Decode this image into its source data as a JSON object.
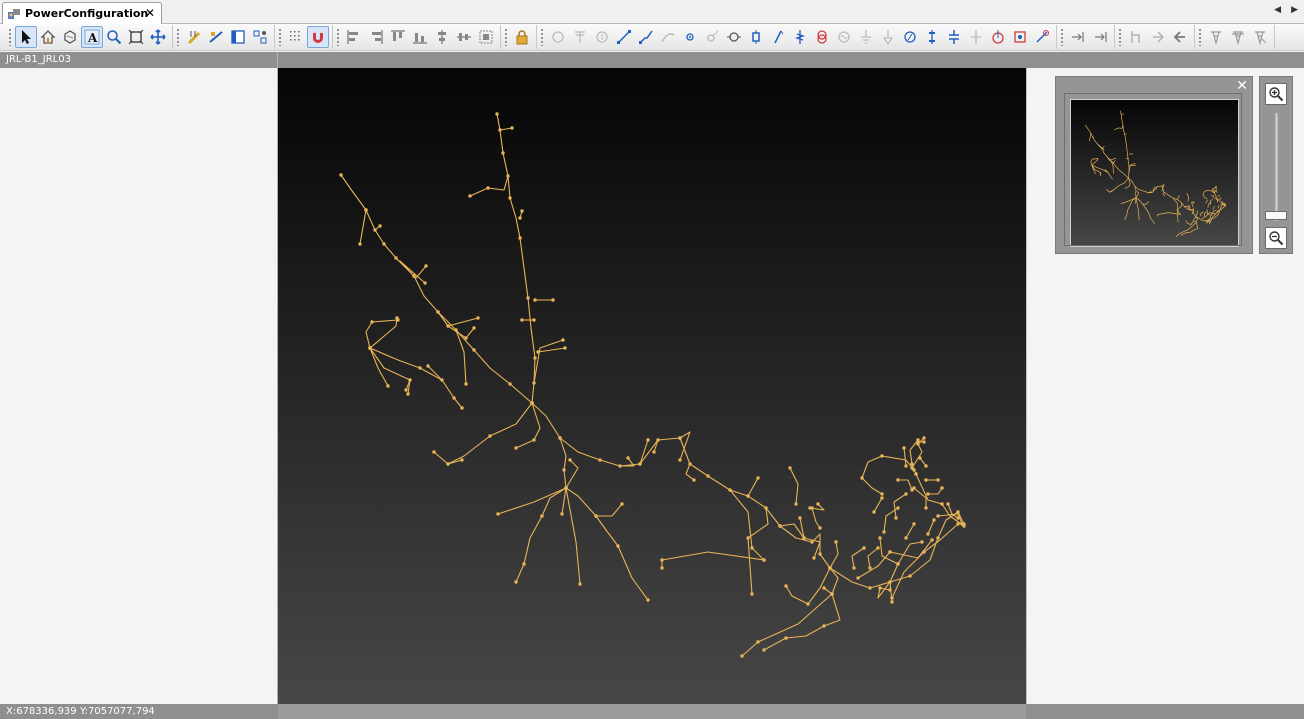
{
  "tab": {
    "label": "PowerConfiguration",
    "close": "✕"
  },
  "tab_nav": {
    "prev": "◀",
    "next": "▶"
  },
  "toolbar": {
    "groups": [
      [
        "select",
        "map-home",
        "pan-select",
        "text",
        "zoom-find",
        "fit-to-extent",
        "move"
      ],
      [
        "ruler",
        "measure",
        "properties",
        "snap-settings"
      ],
      [
        "grid",
        "magnet"
      ],
      [
        "align-left",
        "align-right",
        "align-top",
        "align-bottom",
        "align-middle",
        "align-center",
        "distribute"
      ],
      [
        "lock"
      ],
      [
        "circle",
        "pole-disabled",
        "node-disabled",
        "line",
        "polyline",
        "curve",
        "point-node",
        "arrow-node",
        "target-node",
        "switch",
        "breaker",
        "fuse",
        "transformer",
        "generator",
        "ground",
        "load",
        "regulator",
        "reactor",
        "capacitor",
        "resistor",
        "source",
        "meter",
        "connector"
      ],
      [
        "link-in",
        "link-out"
      ],
      [
        "branch-a",
        "branch-b",
        "branch-c"
      ],
      [
        "tower-a",
        "tower-b",
        "tower-c"
      ]
    ]
  },
  "left_panel": {
    "header": "JRL-B1_JRL03"
  },
  "overview": {
    "close": "✕"
  },
  "status": {
    "coords": "X:678336,939 Y:7057077,794"
  },
  "colors": {
    "network_line": "#e8b456",
    "canvas_top": "#050505",
    "canvas_bottom": "#474747",
    "panel_bar": "#8f8f8f"
  }
}
